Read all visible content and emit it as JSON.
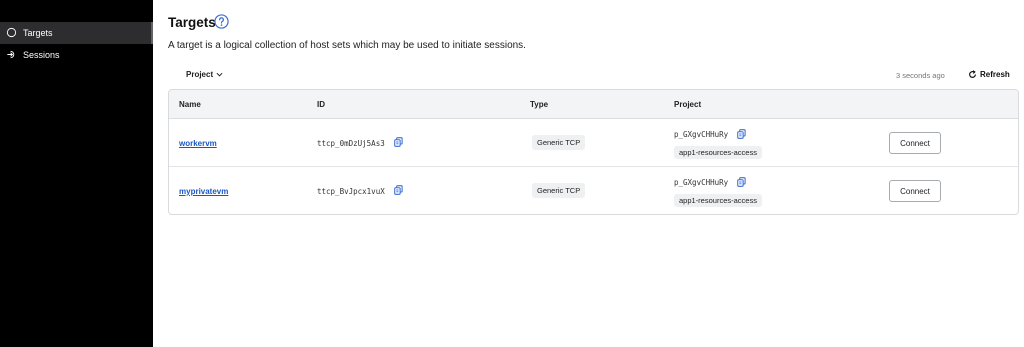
{
  "sidebar": {
    "items": [
      {
        "label": "Targets",
        "icon": "target-icon",
        "active": true
      },
      {
        "label": "Sessions",
        "icon": "login-icon",
        "active": false
      }
    ]
  },
  "page": {
    "title": "Targets",
    "subtitle": "A target is a logical collection of host sets which may be used to initiate sessions."
  },
  "toolbar": {
    "project_filter": "Project",
    "updated": "3 seconds ago",
    "refresh": "Refresh"
  },
  "table": {
    "headers": [
      "Name",
      "ID",
      "Type",
      "Project"
    ],
    "rows": [
      {
        "name": "workervm",
        "id": "ttcp_0mDzUj5As3",
        "type": "Generic TCP",
        "project_id": "p_GXgvCHHuRy",
        "project_name": "app1-resources-access",
        "action": "Connect"
      },
      {
        "name": "myprivatevm",
        "id": "ttcp_BvJpcx1vuX",
        "type": "Generic TCP",
        "project_id": "p_GXgvCHHuRy",
        "project_name": "app1-resources-access",
        "action": "Connect"
      }
    ]
  },
  "colors": {
    "sidebar_bg": "#000000",
    "link": "#1a56c4",
    "help_icon": "#3b6fd4",
    "copy_icon": "#3b6fd4"
  }
}
